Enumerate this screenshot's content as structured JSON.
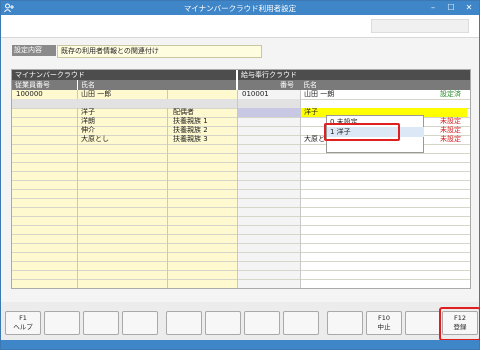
{
  "window": {
    "title": "マイナンバークラウド利用者設定",
    "min": "–",
    "max": "☐",
    "close": "✕"
  },
  "setting": {
    "label": "設定内容",
    "value": "既存の利用者情報との関連付け"
  },
  "left": {
    "section": "マイナンバークラウド",
    "col_id": "従業員番号",
    "col_name": "氏名"
  },
  "right": {
    "section": "給与奉行クラウド",
    "col_id": "番号",
    "col_name": "氏名"
  },
  "rows": [
    {
      "id": "100000",
      "name": "山田 一郎",
      "relation": "",
      "r_id": "010001",
      "r_name": "山田 一朗",
      "status": "設定済"
    },
    {
      "id": "",
      "name": "洋子",
      "relation": "配偶者",
      "r_id": "",
      "r_name": "洋子",
      "status": ""
    },
    {
      "id": "",
      "name": "洋朗",
      "relation": "扶養親族 1",
      "r_id": "",
      "r_name": "",
      "status": "未設定"
    },
    {
      "id": "",
      "name": "伸介",
      "relation": "扶養親族 2",
      "r_id": "",
      "r_name": "",
      "status": "未設定"
    },
    {
      "id": "",
      "name": "大原とし",
      "relation": "扶養親族 3",
      "r_id": "",
      "r_name": "大原とし",
      "status": "未設定"
    }
  ],
  "dropdown": {
    "options": [
      "0 未設定",
      "1 洋子"
    ]
  },
  "fkeys": [
    {
      "num": "F1",
      "label": "ヘルプ"
    },
    {
      "num": "",
      "label": ""
    },
    {
      "num": "",
      "label": ""
    },
    {
      "num": "",
      "label": ""
    },
    {
      "num": "",
      "label": ""
    },
    {
      "num": "",
      "label": ""
    },
    {
      "num": "",
      "label": ""
    },
    {
      "num": "",
      "label": ""
    },
    {
      "num": "",
      "label": ""
    },
    {
      "num": "F10",
      "label": "中止"
    },
    {
      "num": "",
      "label": ""
    },
    {
      "num": "F12",
      "label": "登録"
    }
  ],
  "colors": {
    "accent": "#3f86c8",
    "row_yellow": "#fff9cf",
    "selected": "#ffff00",
    "highlight": "#e02020"
  }
}
